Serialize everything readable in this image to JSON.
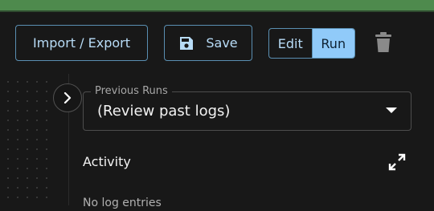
{
  "toolbar": {
    "import_export_label": "Import / Export",
    "save_label": "Save",
    "mode_toggle": {
      "edit_label": "Edit",
      "run_label": "Run",
      "selected": "Run"
    }
  },
  "previous_runs": {
    "label": "Previous Runs",
    "value": "(Review past logs)"
  },
  "activity": {
    "title": "Activity",
    "empty_text": "No log entries"
  },
  "icons": {
    "save": "floppy-disk-icon",
    "delete": "trash-icon",
    "expand": "chevron-right-icon",
    "dropdown": "caret-down-icon",
    "fullscreen": "expand-arrows-icon"
  },
  "colors": {
    "top_bar": "#4e8a4d",
    "accent": "#90caf9",
    "button_text": "#b8dcf7",
    "background": "#181818"
  }
}
